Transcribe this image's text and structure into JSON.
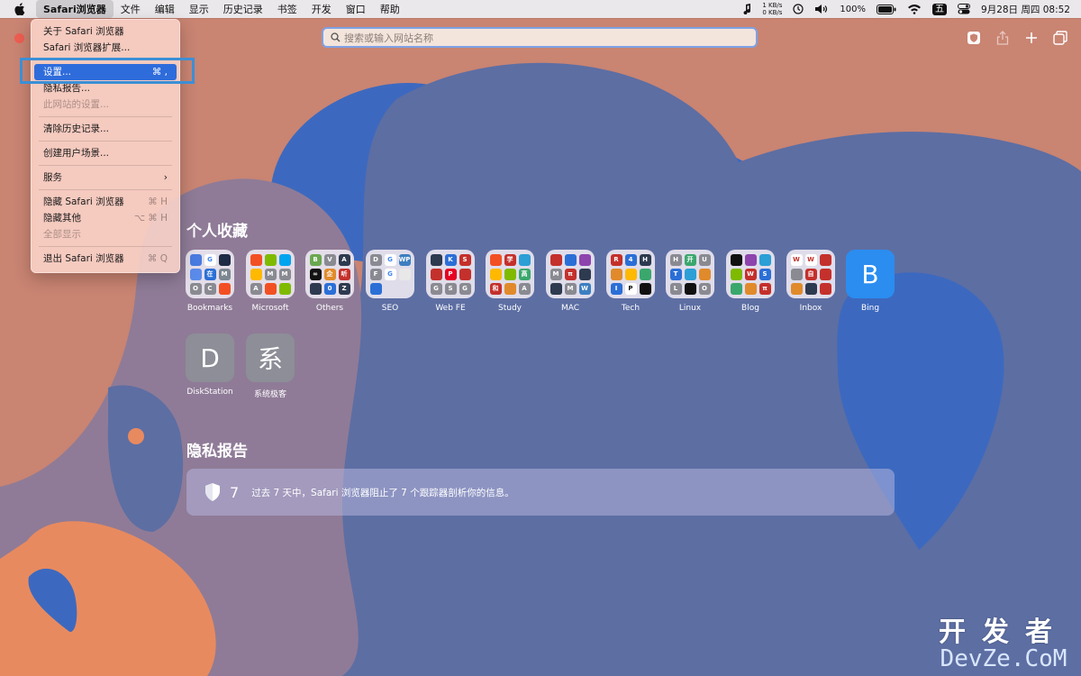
{
  "menubar": {
    "app": "Safari浏览器",
    "items": [
      "文件",
      "编辑",
      "显示",
      "历史记录",
      "书签",
      "开发",
      "窗口",
      "帮助"
    ],
    "net_up": "1 KB/s",
    "net_down": "0 KB/s",
    "battery": "100%",
    "input_method": "五",
    "datetime": "9月28日 周四  08:52"
  },
  "toolbar": {
    "search_placeholder": "搜索或输入网站名称"
  },
  "app_menu": {
    "about": "关于 Safari 浏览器",
    "extensions": "Safari 浏览器扩展...",
    "settings": "设置...",
    "settings_shortcut": "⌘ ,",
    "privacy_report": "隐私报告...",
    "site_settings": "此网站的设置...",
    "clear_history": "清除历史记录...",
    "create_profile": "创建用户场景...",
    "services": "服务",
    "services_arrow": "›",
    "hide_safari": "隐藏 Safari 浏览器",
    "hide_safari_shortcut": "⌘ H",
    "hide_others": "隐藏其他",
    "hide_others_shortcut": "⌥ ⌘ H",
    "show_all": "全部显示",
    "quit": "退出 Safari 浏览器",
    "quit_shortcut": "⌘ Q"
  },
  "favorites": {
    "title": "个人收藏",
    "items": [
      {
        "label": "Bookmarks"
      },
      {
        "label": "Microsoft"
      },
      {
        "label": "Others"
      },
      {
        "label": "SEO"
      },
      {
        "label": "Web FE"
      },
      {
        "label": "Study"
      },
      {
        "label": "MAC"
      },
      {
        "label": "Tech"
      },
      {
        "label": "Linux"
      },
      {
        "label": "Blog"
      },
      {
        "label": "Inbox"
      },
      {
        "label": "Bing",
        "letter": "B"
      },
      {
        "label": "DiskStation",
        "letter": "D"
      },
      {
        "label": "系统极客",
        "letter": "系"
      }
    ]
  },
  "privacy": {
    "title": "隐私报告",
    "count": "7",
    "message": "过去 7 天中，Safari 浏览器阻止了 7 个跟踪器剖析你的信息。"
  },
  "watermark": {
    "cn": "开发者",
    "en": "DevZe.CoM"
  },
  "colors": {
    "background": "#c98472",
    "blob_blue": "#3c69bf",
    "blob_slate": "#5d6ea3",
    "accent": "#2f6cdb",
    "close": "#ee5d52",
    "highlight": "#3b8fd6"
  }
}
